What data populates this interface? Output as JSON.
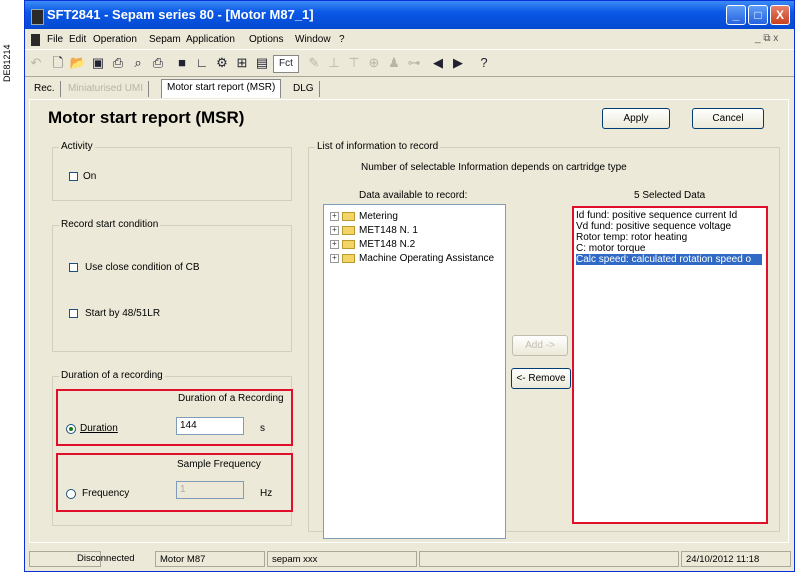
{
  "side_tag": "DE81214",
  "window": {
    "title": "SFT2841 - Sepam series 80 - [Motor M87_1]",
    "controls": {
      "minimize": "_",
      "maximize": "□",
      "close": "X"
    }
  },
  "menu": {
    "items": [
      "File",
      "Edit",
      "Operation",
      "Sepam",
      "Application",
      "Options",
      "Window",
      "?"
    ],
    "mdi_controls": "_ ⧉ x"
  },
  "toolbar": {
    "fct_label": "Fct",
    "icons": [
      "undo-icon",
      "new-file-icon",
      "open-folder-icon",
      "save-icon",
      "print-setup-icon",
      "print-preview-icon",
      "print-icon",
      "save-disk-icon",
      "curve-icon",
      "settings-icon",
      "matrix-icon",
      "logic-icon",
      "fct-icon",
      "wand-icon",
      "connect-icon",
      "disconnect-icon",
      "tree-icon",
      "person-icon",
      "network-icon",
      "arrow-left-icon",
      "arrow-right-icon",
      "help-icon"
    ]
  },
  "tabs": [
    {
      "label": "Rec.",
      "state": "normal"
    },
    {
      "label": "Miniaturised UMI",
      "state": "disabled"
    },
    {
      "label": "Motor start report (MSR)",
      "state": "active"
    },
    {
      "label": "DLG",
      "state": "normal"
    }
  ],
  "panel": {
    "title": "Motor start report (MSR)",
    "apply_label": "Apply",
    "cancel_label": "Cancel",
    "activity": {
      "label": "Activity",
      "on_label": "On"
    },
    "record_start": {
      "label": "Record start condition",
      "use_close_label": "Use close condition of CB",
      "start_by_label": "Start by 48/51LR"
    },
    "duration_group": {
      "label": "Duration of a recording",
      "duration_header": "Duration of a Recording",
      "duration_label": "Duration",
      "duration_value": "144",
      "duration_unit": "s",
      "frequency_header": "Sample Frequency",
      "frequency_label": "Frequency",
      "frequency_value": "1",
      "frequency_unit": "Hz"
    },
    "info_group": {
      "label": "List of information to record",
      "note": "Number of  selectable Information depends on cartridge type",
      "available_header": "Data available to record:",
      "selected_header": "5 Selected Data",
      "tree": [
        "Metering",
        "MET148 N. 1",
        "MET148 N.2",
        "Machine Operating Assistance"
      ],
      "add_label": "Add ->",
      "remove_label": "<- Remove",
      "selected": [
        "Id fund: positive sequence current Id",
        "Vd fund: positive sequence voltage",
        "Rotor temp: rotor heating",
        "C: motor torque",
        "Calc speed: calculated rotation speed o"
      ]
    }
  },
  "status": {
    "connection": "Disconnected",
    "device": "Motor M87",
    "model": "sepam xxx",
    "datetime": "24/10/2012 11:18"
  },
  "colors": {
    "highlight_box": "#e0102a",
    "selection": "#316ac5",
    "titlebar": "#0a58e6"
  }
}
